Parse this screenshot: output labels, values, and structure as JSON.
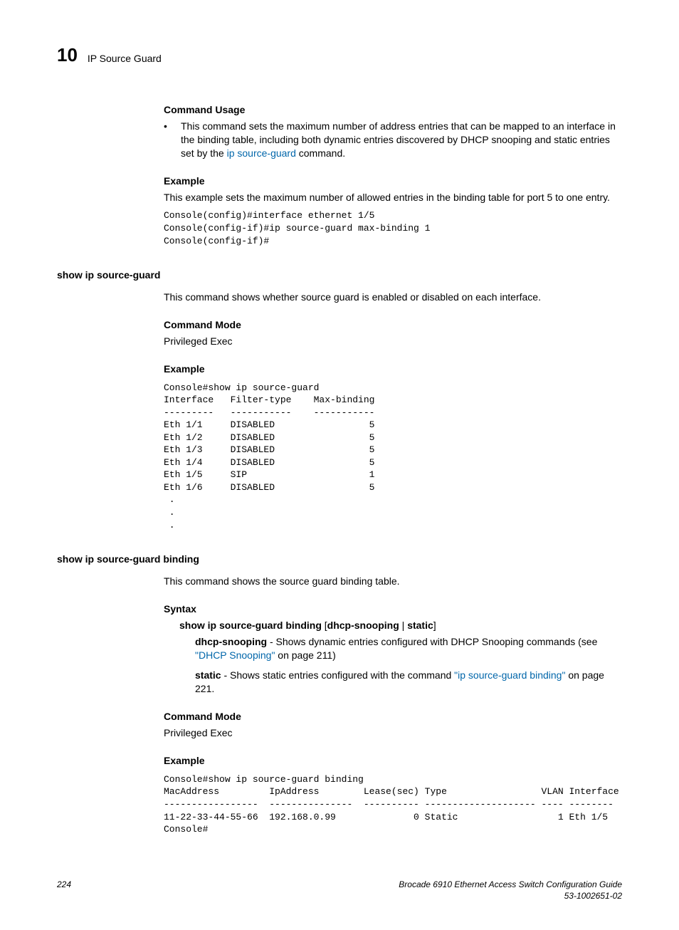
{
  "header": {
    "chapterNumber": "10",
    "chapterTitle": "IP Source Guard"
  },
  "section1": {
    "h_usage": "Command Usage",
    "bullet1_a": "This command sets the maximum number of address entries that can be mapped to an interface in the binding table, including both dynamic entries discovered by DHCP snooping and static entries set by the ",
    "bullet1_link": "ip source-guard",
    "bullet1_b": " command.",
    "h_example": "Example",
    "example_text": "This example sets the maximum number of allowed entries in the binding table for port 5 to one entry.",
    "code": "Console(config)#interface ethernet 1/5\nConsole(config-if)#ip source-guard max-binding 1\nConsole(config-if)#"
  },
  "section2": {
    "left_heading": "show ip source-guard",
    "intro": "This command shows whether source guard is enabled or disabled on each interface.",
    "h_mode": "Command Mode",
    "mode_text": "Privileged Exec",
    "h_example": "Example",
    "code": "Console#show ip source-guard\nInterface   Filter-type    Max-binding\n---------   -----------    -----------\nEth 1/1     DISABLED                 5\nEth 1/2     DISABLED                 5\nEth 1/3     DISABLED                 5\nEth 1/4     DISABLED                 5\nEth 1/5     SIP                      1\nEth 1/6     DISABLED                 5\n .\n .\n ."
  },
  "section3": {
    "left_heading": "show ip source-guard binding",
    "intro": "This command shows the source guard binding table.",
    "h_syntax": "Syntax",
    "syntax_cmd_a": "show ip source-guard binding",
    "syntax_cmd_b": " [",
    "syntax_cmd_c": "dhcp-snooping",
    "syntax_cmd_d": " | ",
    "syntax_cmd_e": "static",
    "syntax_cmd_f": "]",
    "dhcp_label": "dhcp-snooping",
    "dhcp_text_a": " - Shows dynamic entries configured with DHCP Snooping commands (see ",
    "dhcp_link": "\"DHCP Snooping\"",
    "dhcp_text_b": " on page 211)",
    "static_label": "static",
    "static_text_a": " - Shows static entries configured with the command ",
    "static_link": "\"ip source-guard binding\"",
    "static_text_b": " on page 221.",
    "h_mode": "Command Mode",
    "mode_text": "Privileged Exec",
    "h_example": "Example",
    "code": "Console#show ip source-guard binding\nMacAddress         IpAddress        Lease(sec) Type                 VLAN Interface\n-----------------  ---------------  ---------- -------------------- ---- --------\n11-22-33-44-55-66  192.168.0.99              0 Static                  1 Eth 1/5\nConsole#"
  },
  "footer": {
    "page": "224",
    "book": "Brocade 6910 Ethernet Access Switch Configuration Guide",
    "docnum": "53-1002651-02"
  }
}
